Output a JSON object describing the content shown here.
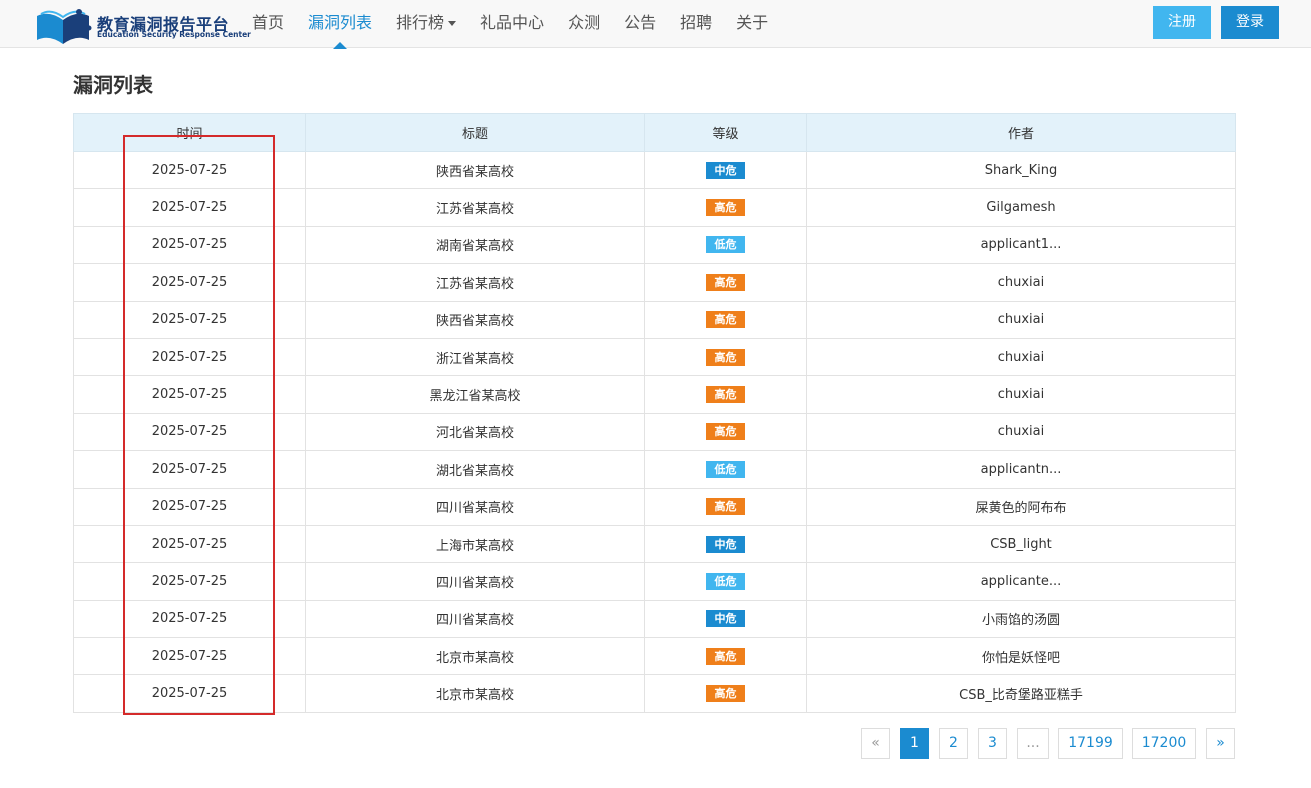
{
  "brand": {
    "name_cn": "教育漏洞报告平台",
    "name_en": "Education Security Response Center",
    "primary_color": "#1b8bd0",
    "logo_color": "#1a3f7a"
  },
  "nav": {
    "items": [
      {
        "label": "首页"
      },
      {
        "label": "漏洞列表"
      },
      {
        "label": "排行榜"
      },
      {
        "label": "礼品中心"
      },
      {
        "label": "众测"
      },
      {
        "label": "公告"
      },
      {
        "label": "招聘"
      },
      {
        "label": "关于"
      }
    ],
    "active": "漏洞列表",
    "register_label": "注册",
    "login_label": "登录"
  },
  "page": {
    "title": "漏洞列表"
  },
  "table": {
    "headers": [
      "时间",
      "标题",
      "等级",
      "作者"
    ],
    "level_colors": {
      "中危": "#1b8bd0",
      "高危": "#ef7f1a",
      "低危": "#41b6ef"
    },
    "rows": [
      {
        "date": "2025-07-25",
        "title": "陕西省某高校",
        "level": "中危",
        "author": "Shark_King"
      },
      {
        "date": "2025-07-25",
        "title": "江苏省某高校",
        "level": "高危",
        "author": "Gilgamesh"
      },
      {
        "date": "2025-07-25",
        "title": "湖南省某高校",
        "level": "低危",
        "author": "applicant1..."
      },
      {
        "date": "2025-07-25",
        "title": "江苏省某高校",
        "level": "高危",
        "author": "chuxiai"
      },
      {
        "date": "2025-07-25",
        "title": "陕西省某高校",
        "level": "高危",
        "author": "chuxiai"
      },
      {
        "date": "2025-07-25",
        "title": "浙江省某高校",
        "level": "高危",
        "author": "chuxiai"
      },
      {
        "date": "2025-07-25",
        "title": "黑龙江省某高校",
        "level": "高危",
        "author": "chuxiai"
      },
      {
        "date": "2025-07-25",
        "title": "河北省某高校",
        "level": "高危",
        "author": "chuxiai"
      },
      {
        "date": "2025-07-25",
        "title": "湖北省某高校",
        "level": "低危",
        "author": "applicantn..."
      },
      {
        "date": "2025-07-25",
        "title": "四川省某高校",
        "level": "高危",
        "author": "屎黄色的阿布布"
      },
      {
        "date": "2025-07-25",
        "title": "上海市某高校",
        "level": "中危",
        "author": "CSB_light"
      },
      {
        "date": "2025-07-25",
        "title": "四川省某高校",
        "level": "低危",
        "author": "applicante..."
      },
      {
        "date": "2025-07-25",
        "title": "四川省某高校",
        "level": "中危",
        "author": "小雨馅的汤圆"
      },
      {
        "date": "2025-07-25",
        "title": "北京市某高校",
        "level": "高危",
        "author": "你怕是妖怪吧"
      },
      {
        "date": "2025-07-25",
        "title": "北京市某高校",
        "level": "高危",
        "author": "CSB_比奇堡路亚糕手"
      }
    ]
  },
  "pagination": {
    "prev": "«",
    "next": "»",
    "pages": [
      "1",
      "2",
      "3",
      "...",
      "17199",
      "17200"
    ],
    "current": "1"
  }
}
